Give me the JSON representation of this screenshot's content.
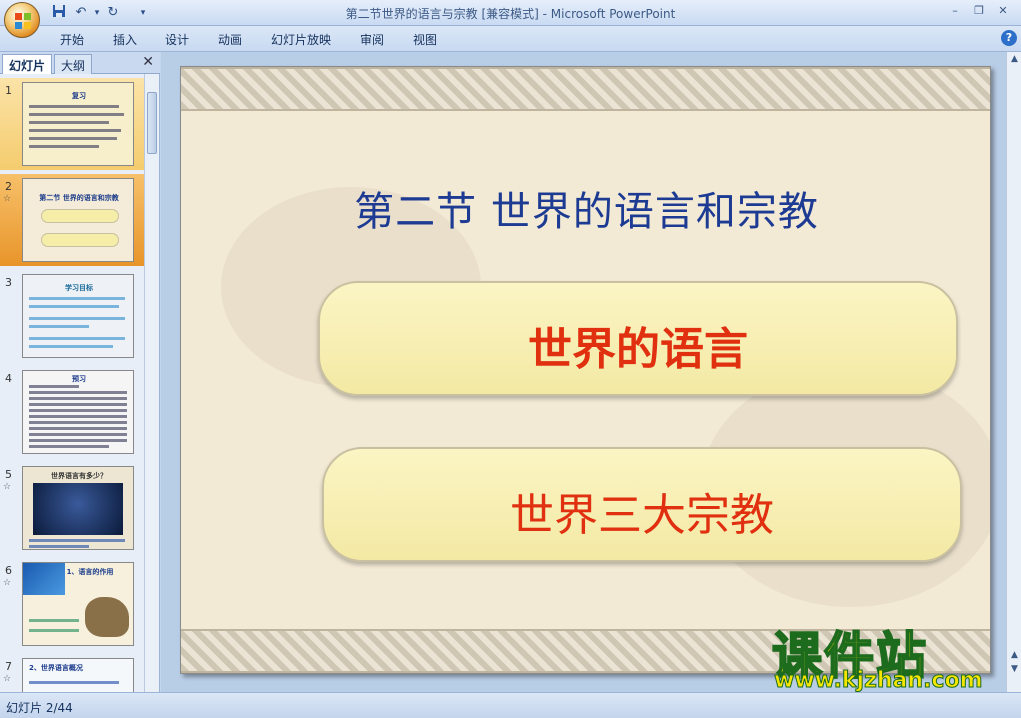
{
  "window": {
    "title": "第二节世界的语言与宗教 [兼容模式] - Microsoft PowerPoint"
  },
  "quick_access": {
    "save_icon": "save-icon",
    "undo_icon": "undo-icon",
    "redo_icon": "redo-icon"
  },
  "menu": {
    "items": [
      "开始",
      "插入",
      "设计",
      "动画",
      "幻灯片放映",
      "审阅",
      "视图"
    ]
  },
  "left_pane": {
    "tab_slides": "幻灯片",
    "tab_outline": "大纲",
    "thumbnails": [
      {
        "num": "1",
        "title": "复习",
        "star": false
      },
      {
        "num": "2",
        "title": "第二节 世界的语言和宗教",
        "star": true
      },
      {
        "num": "3",
        "title": "学习目标",
        "star": false
      },
      {
        "num": "4",
        "title": "预习",
        "star": false
      },
      {
        "num": "5",
        "title": "世界语言有多少？",
        "star": true
      },
      {
        "num": "6",
        "title": "1、语言的作用",
        "star": true
      },
      {
        "num": "7",
        "title": "2、世界语言概况",
        "star": true
      }
    ]
  },
  "slide": {
    "title": "第二节    世界的语言和宗教",
    "button_1": "世界的语言",
    "button_2": "世界三大宗教"
  },
  "status": {
    "slide_info": "幻灯片 2/44"
  },
  "watermark": {
    "title": "课件站",
    "url": "www.kjzhan.com"
  },
  "colors": {
    "title_blue": "#1d3b93",
    "button_text_red": "#e03010",
    "pill_fill": "#f7efb4"
  }
}
